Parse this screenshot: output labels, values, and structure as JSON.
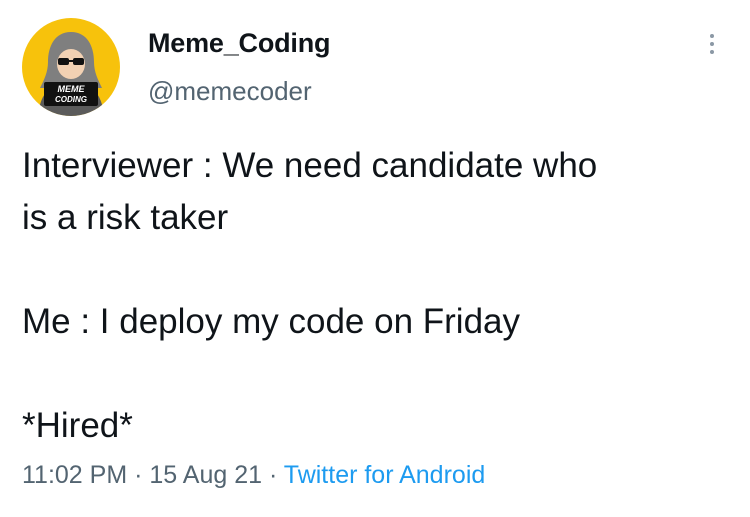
{
  "tweet": {
    "author": {
      "display_name": "Meme_Coding",
      "handle": "@memecoder",
      "avatar_badge_line1": "MEME",
      "avatar_badge_line2": "CODING",
      "avatar_bg_color": "#f7c20c"
    },
    "more_icon": "more-vertical-icon",
    "text_lines": [
      "Interviewer : We need candidate who",
      "is a risk taker",
      "Me : I deploy my code on Friday",
      "*Hired*"
    ],
    "meta": {
      "time": "11:02 PM",
      "separator": "·",
      "date": "15 Aug 21",
      "source": "Twitter for Android",
      "source_color": "#1d9bf0"
    }
  }
}
